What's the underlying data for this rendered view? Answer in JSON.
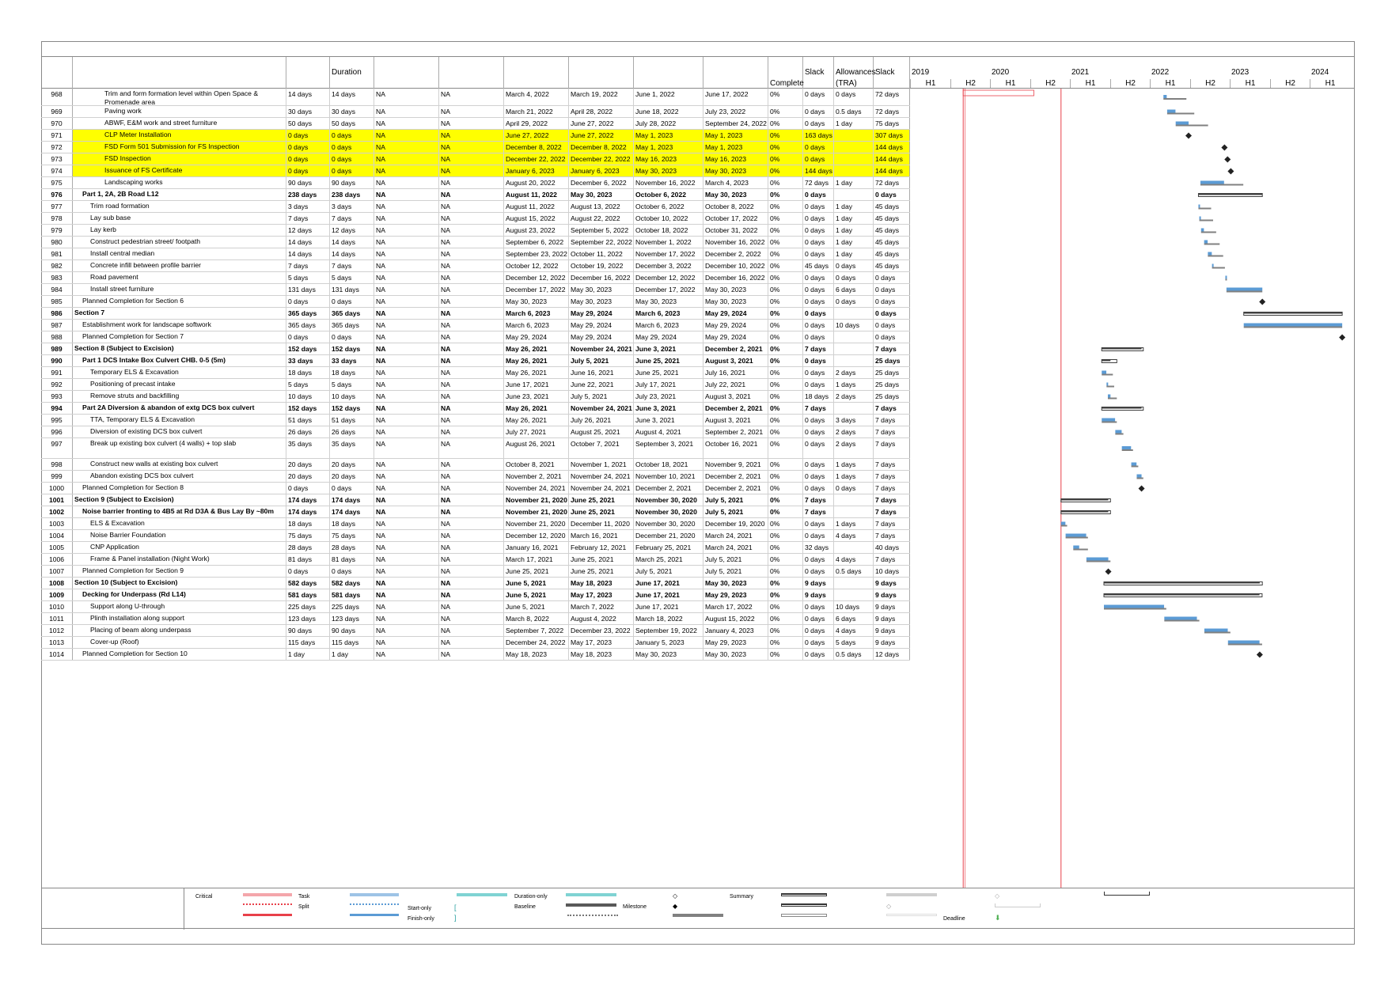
{
  "header": {
    "duration_label": "Duration",
    "complete_label": "Complete",
    "slack_label": "Slack",
    "allowances_label_1": "Allowances",
    "allowances_label_2": "(TRA)",
    "slack2_label": "Slack"
  },
  "timeline": {
    "years": [
      "2019",
      "2020",
      "2021",
      "2022",
      "2023",
      "2024"
    ],
    "halves": [
      "H1",
      "H2",
      "H1",
      "H2",
      "H1",
      "H2",
      "H1",
      "H2",
      "H1",
      "H2",
      "H1"
    ]
  },
  "rows": [
    {
      "id": "968",
      "name": "Trim and form formation level within Open Space & Promenade area",
      "d1": "14 days",
      "d2": "14 days",
      "n1": "NA",
      "n2": "NA",
      "s": "March 4, 2022",
      "f": "March 19, 2022",
      "s2": "June 1, 2022",
      "f2": "June 17, 2022",
      "pc": "0%",
      "sl": "0 days",
      "al": "0 days",
      "sl2": "72 days",
      "lv": 3,
      "tall": 1
    },
    {
      "id": "969",
      "name": "Paving work",
      "d1": "30 days",
      "d2": "30 days",
      "n1": "NA",
      "n2": "NA",
      "s": "March 21, 2022",
      "f": "April 28, 2022",
      "s2": "June 18, 2022",
      "f2": "July 23, 2022",
      "pc": "0%",
      "sl": "0 days",
      "al": "0.5 days",
      "sl2": "72 days",
      "lv": 3
    },
    {
      "id": "970",
      "name": "ABWF, E&M work and street furniture",
      "d1": "50 days",
      "d2": "50 days",
      "n1": "NA",
      "n2": "NA",
      "s": "April 29, 2022",
      "f": "June 27, 2022",
      "s2": "July 28, 2022",
      "f2": "September 24, 2022",
      "pc": "0%",
      "sl": "0 days",
      "al": "1 day",
      "sl2": "75 days",
      "lv": 3
    },
    {
      "id": "971",
      "name": "CLP Meter Installation",
      "d1": "0 days",
      "d2": "0 days",
      "n1": "NA",
      "n2": "NA",
      "s": "June 27, 2022",
      "f": "June 27, 2022",
      "s2": "May 1, 2023",
      "f2": "May 1, 2023",
      "pc": "0%",
      "sl": "163 days",
      "al": "",
      "sl2": "307 days",
      "lv": 3,
      "hl": 1
    },
    {
      "id": "972",
      "name": "FSD Form 501 Submission for FS Inspection",
      "d1": "0 days",
      "d2": "0 days",
      "n1": "NA",
      "n2": "NA",
      "s": "December 8, 2022",
      "f": "December 8, 2022",
      "s2": "May 1, 2023",
      "f2": "May 1, 2023",
      "pc": "0%",
      "sl": "0 days",
      "al": "",
      "sl2": "144 days",
      "lv": 3,
      "hl": 1
    },
    {
      "id": "973",
      "name": "FSD Inspection",
      "d1": "0 days",
      "d2": "0 days",
      "n1": "NA",
      "n2": "NA",
      "s": "December 22, 2022",
      "f": "December 22, 2022",
      "s2": "May 16, 2023",
      "f2": "May 16, 2023",
      "pc": "0%",
      "sl": "0 days",
      "al": "",
      "sl2": "144 days",
      "lv": 3,
      "hl": 1
    },
    {
      "id": "974",
      "name": "Issuance of FS Certificate",
      "d1": "0 days",
      "d2": "0 days",
      "n1": "NA",
      "n2": "NA",
      "s": "January 6, 2023",
      "f": "January 6, 2023",
      "s2": "May 30, 2023",
      "f2": "May 30, 2023",
      "pc": "0%",
      "sl": "144 days",
      "al": "",
      "sl2": "144 days",
      "lv": 3,
      "hl": 1
    },
    {
      "id": "975",
      "name": "Landscaping works",
      "d1": "90 days",
      "d2": "90 days",
      "n1": "NA",
      "n2": "NA",
      "s": "August 20, 2022",
      "f": "December 6, 2022",
      "s2": "November 16, 2022",
      "f2": "March 4, 2023",
      "pc": "0%",
      "sl": "72 days",
      "al": "1 day",
      "sl2": "72 days",
      "lv": 3
    },
    {
      "id": "976",
      "name": "Part 1, 2A, 2B   Road L12",
      "d1": "238 days",
      "d2": "238 days",
      "n1": "NA",
      "n2": "NA",
      "s": "August 11, 2022",
      "f": "May 30, 2023",
      "s2": "October 6, 2022",
      "f2": "May 30, 2023",
      "pc": "0%",
      "sl": "0 days",
      "al": "",
      "sl2": "0 days",
      "lv": 1,
      "b": 1
    },
    {
      "id": "977",
      "name": "Trim road formation",
      "d1": "3 days",
      "d2": "3 days",
      "n1": "NA",
      "n2": "NA",
      "s": "August 11, 2022",
      "f": "August 13, 2022",
      "s2": "October 6, 2022",
      "f2": "October 8, 2022",
      "pc": "0%",
      "sl": "0 days",
      "al": "1 day",
      "sl2": "45 days",
      "lv": 2
    },
    {
      "id": "978",
      "name": "Lay sub base",
      "d1": "7 days",
      "d2": "7 days",
      "n1": "NA",
      "n2": "NA",
      "s": "August 15, 2022",
      "f": "August 22, 2022",
      "s2": "October 10, 2022",
      "f2": "October 17, 2022",
      "pc": "0%",
      "sl": "0 days",
      "al": "1 day",
      "sl2": "45 days",
      "lv": 2
    },
    {
      "id": "979",
      "name": "Lay kerb",
      "d1": "12 days",
      "d2": "12 days",
      "n1": "NA",
      "n2": "NA",
      "s": "August 23, 2022",
      "f": "September 5, 2022",
      "s2": "October 18, 2022",
      "f2": "October 31, 2022",
      "pc": "0%",
      "sl": "0 days",
      "al": "1 day",
      "sl2": "45 days",
      "lv": 2
    },
    {
      "id": "980",
      "name": "Construct pedestrian street/ footpath",
      "d1": "14 days",
      "d2": "14 days",
      "n1": "NA",
      "n2": "NA",
      "s": "September 6, 2022",
      "f": "September 22, 2022",
      "s2": "November 1, 2022",
      "f2": "November 16, 2022",
      "pc": "0%",
      "sl": "0 days",
      "al": "1 day",
      "sl2": "45 days",
      "lv": 2
    },
    {
      "id": "981",
      "name": "Install central median",
      "d1": "14 days",
      "d2": "14 days",
      "n1": "NA",
      "n2": "NA",
      "s": "September 23, 2022",
      "f": "October 11, 2022",
      "s2": "November 17, 2022",
      "f2": "December 2, 2022",
      "pc": "0%",
      "sl": "0 days",
      "al": "1 day",
      "sl2": "45 days",
      "lv": 2
    },
    {
      "id": "982",
      "name": "Concrete infill between profile barrier",
      "d1": "7 days",
      "d2": "7 days",
      "n1": "NA",
      "n2": "NA",
      "s": "October 12, 2022",
      "f": "October 19, 2022",
      "s2": "December 3, 2022",
      "f2": "December 10, 2022",
      "pc": "0%",
      "sl": "45 days",
      "al": "0 days",
      "sl2": "45 days",
      "lv": 2
    },
    {
      "id": "983",
      "name": "Road pavement",
      "d1": "5 days",
      "d2": "5 days",
      "n1": "NA",
      "n2": "NA",
      "s": "December 12, 2022",
      "f": "December 16, 2022",
      "s2": "December 12, 2022",
      "f2": "December 16, 2022",
      "pc": "0%",
      "sl": "0 days",
      "al": "0 days",
      "sl2": "0 days",
      "lv": 2
    },
    {
      "id": "984",
      "name": "Install street furniture",
      "d1": "131 days",
      "d2": "131 days",
      "n1": "NA",
      "n2": "NA",
      "s": "December 17, 2022",
      "f": "May 30, 2023",
      "s2": "December 17, 2022",
      "f2": "May 30, 2023",
      "pc": "0%",
      "sl": "0 days",
      "al": "6 days",
      "sl2": "0 days",
      "lv": 2
    },
    {
      "id": "985",
      "name": "Planned Completion for Section 6",
      "d1": "0 days",
      "d2": "0 days",
      "n1": "NA",
      "n2": "NA",
      "s": "May 30, 2023",
      "f": "May 30, 2023",
      "s2": "May 30, 2023",
      "f2": "May 30, 2023",
      "pc": "0%",
      "sl": "0 days",
      "al": "0 days",
      "sl2": "0 days",
      "lv": 1
    },
    {
      "id": "986",
      "name": "Section 7",
      "d1": "365 days",
      "d2": "365 days",
      "n1": "NA",
      "n2": "NA",
      "s": "March 6, 2023",
      "f": "May 29, 2024",
      "s2": "March 6, 2023",
      "f2": "May 29, 2024",
      "pc": "0%",
      "sl": "0 days",
      "al": "",
      "sl2": "0 days",
      "lv": 0,
      "b": 1
    },
    {
      "id": "987",
      "name": "Establishment work for landscape softwork",
      "d1": "365 days",
      "d2": "365 days",
      "n1": "NA",
      "n2": "NA",
      "s": "March 6, 2023",
      "f": "May 29, 2024",
      "s2": "March 6, 2023",
      "f2": "May 29, 2024",
      "pc": "0%",
      "sl": "0 days",
      "al": "10 days",
      "sl2": "0 days",
      "lv": 1
    },
    {
      "id": "988",
      "name": "Planned Completion for Section 7",
      "d1": "0 days",
      "d2": "0 days",
      "n1": "NA",
      "n2": "NA",
      "s": "May 29, 2024",
      "f": "May 29, 2024",
      "s2": "May 29, 2024",
      "f2": "May 29, 2024",
      "pc": "0%",
      "sl": "0 days",
      "al": "",
      "sl2": "0 days",
      "lv": 1
    },
    {
      "id": "989",
      "name": "Section 8 (Subject to Excision)",
      "d1": "152 days",
      "d2": "152 days",
      "n1": "NA",
      "n2": "NA",
      "s": "May 26, 2021",
      "f": "November 24, 2021",
      "s2": "June 3, 2021",
      "f2": "December 2, 2021",
      "pc": "0%",
      "sl": "7 days",
      "al": "",
      "sl2": "7 days",
      "lv": 0,
      "b": 1
    },
    {
      "id": "990",
      "name": "Part 1   DCS Intake Box Culvert   CHB. 0-5 (5m)",
      "d1": "33 days",
      "d2": "33 days",
      "n1": "NA",
      "n2": "NA",
      "s": "May 26, 2021",
      "f": "July 5, 2021",
      "s2": "June 25, 2021",
      "f2": "August 3, 2021",
      "pc": "0%",
      "sl": "0 days",
      "al": "",
      "sl2": "25 days",
      "lv": 1,
      "b": 1
    },
    {
      "id": "991",
      "name": "Temporary ELS & Excavation",
      "d1": "18 days",
      "d2": "18 days",
      "n1": "NA",
      "n2": "NA",
      "s": "May 26, 2021",
      "f": "June 16, 2021",
      "s2": "June 25, 2021",
      "f2": "July 16, 2021",
      "pc": "0%",
      "sl": "0 days",
      "al": "2 days",
      "sl2": "25 days",
      "lv": 2
    },
    {
      "id": "992",
      "name": "Positioning of precast intake",
      "d1": "5 days",
      "d2": "5 days",
      "n1": "NA",
      "n2": "NA",
      "s": "June 17, 2021",
      "f": "June 22, 2021",
      "s2": "July 17, 2021",
      "f2": "July 22, 2021",
      "pc": "0%",
      "sl": "0 days",
      "al": "1 days",
      "sl2": "25 days",
      "lv": 2
    },
    {
      "id": "993",
      "name": "Remove struts and backfilling",
      "d1": "10 days",
      "d2": "10 days",
      "n1": "NA",
      "n2": "NA",
      "s": "June 23, 2021",
      "f": "July 5, 2021",
      "s2": "July 23, 2021",
      "f2": "August 3, 2021",
      "pc": "0%",
      "sl": "18 days",
      "al": "2 days",
      "sl2": "25 days",
      "lv": 2
    },
    {
      "id": "994",
      "name": "Part 2A   Diversion & abandon of extg DCS box culvert",
      "d1": "152 days",
      "d2": "152 days",
      "n1": "NA",
      "n2": "NA",
      "s": "May 26, 2021",
      "f": "November 24, 2021",
      "s2": "June 3, 2021",
      "f2": "December 2, 2021",
      "pc": "0%",
      "sl": "7 days",
      "al": "",
      "sl2": "7 days",
      "lv": 1,
      "b": 1
    },
    {
      "id": "995",
      "name": "TTA, Temporary ELS & Excavation",
      "d1": "51 days",
      "d2": "51 days",
      "n1": "NA",
      "n2": "NA",
      "s": "May 26, 2021",
      "f": "July 26, 2021",
      "s2": "June 3, 2021",
      "f2": "August 3, 2021",
      "pc": "0%",
      "sl": "0 days",
      "al": "3 days",
      "sl2": "7 days",
      "lv": 2
    },
    {
      "id": "996",
      "name": "Diversion of existing DCS box culvert",
      "d1": "26 days",
      "d2": "26 days",
      "n1": "NA",
      "n2": "NA",
      "s": "July 27, 2021",
      "f": "August 25, 2021",
      "s2": "August 4, 2021",
      "f2": "September 2, 2021",
      "pc": "0%",
      "sl": "0 days",
      "al": "2 days",
      "sl2": "7 days",
      "lv": 2
    },
    {
      "id": "997",
      "name": "Break up existing box culvert (4 walls) + top slab",
      "d1": "35 days",
      "d2": "35 days",
      "n1": "NA",
      "n2": "NA",
      "s": "August 26, 2021",
      "f": "October 7, 2021",
      "s2": "September 3, 2021",
      "f2": "October 16, 2021",
      "pc": "0%",
      "sl": "0 days",
      "al": "2 days",
      "sl2": "7 days",
      "lv": 2,
      "tall": 2
    },
    {
      "id": "998",
      "name": "Construct new walls at existing box culvert",
      "d1": "20 days",
      "d2": "20 days",
      "n1": "NA",
      "n2": "NA",
      "s": "October 8, 2021",
      "f": "November 1, 2021",
      "s2": "October 18, 2021",
      "f2": "November 9, 2021",
      "pc": "0%",
      "sl": "0 days",
      "al": "1 days",
      "sl2": "7 days",
      "lv": 2
    },
    {
      "id": "999",
      "name": "Abandon existing DCS box culvert",
      "d1": "20 days",
      "d2": "20 days",
      "n1": "NA",
      "n2": "NA",
      "s": "November 2, 2021",
      "f": "November 24, 2021",
      "s2": "November 10, 2021",
      "f2": "December 2, 2021",
      "pc": "0%",
      "sl": "0 days",
      "al": "1 days",
      "sl2": "7 days",
      "lv": 2
    },
    {
      "id": "1000",
      "name": "Planned Completion for Section 8",
      "d1": "0 days",
      "d2": "0 days",
      "n1": "NA",
      "n2": "NA",
      "s": "November 24, 2021",
      "f": "November 24, 2021",
      "s2": "December 2, 2021",
      "f2": "December 2, 2021",
      "pc": "0%",
      "sl": "0 days",
      "al": "0 days",
      "sl2": "7 days",
      "lv": 1
    },
    {
      "id": "1001",
      "name": "Section 9 (Subject to Excision)",
      "d1": "174 days",
      "d2": "174 days",
      "n1": "NA",
      "n2": "NA",
      "s": "November 21, 2020",
      "f": "June 25, 2021",
      "s2": "November 30, 2020",
      "f2": "July 5, 2021",
      "pc": "0%",
      "sl": "7 days",
      "al": "",
      "sl2": "7 days",
      "lv": 0,
      "b": 1
    },
    {
      "id": "1002",
      "name": "Noise barrier fronting to 4B5 at Rd D3A & Bus Lay By ~80m",
      "d1": "174 days",
      "d2": "174 days",
      "n1": "NA",
      "n2": "NA",
      "s": "November 21, 2020",
      "f": "June 25, 2021",
      "s2": "November 30, 2020",
      "f2": "July 5, 2021",
      "pc": "0%",
      "sl": "7 days",
      "al": "",
      "sl2": "7 days",
      "lv": 1,
      "b": 1
    },
    {
      "id": "1003",
      "name": "ELS & Excavation",
      "d1": "18 days",
      "d2": "18 days",
      "n1": "NA",
      "n2": "NA",
      "s": "November 21, 2020",
      "f": "December 11, 2020",
      "s2": "November 30, 2020",
      "f2": "December 19, 2020",
      "pc": "0%",
      "sl": "0 days",
      "al": "1 days",
      "sl2": "7 days",
      "lv": 2
    },
    {
      "id": "1004",
      "name": "Noise Barrier Foundation",
      "d1": "75 days",
      "d2": "75 days",
      "n1": "NA",
      "n2": "NA",
      "s": "December 12, 2020",
      "f": "March 16, 2021",
      "s2": "December 21, 2020",
      "f2": "March 24, 2021",
      "pc": "0%",
      "sl": "0 days",
      "al": "4 days",
      "sl2": "7 days",
      "lv": 2
    },
    {
      "id": "1005",
      "name": "CNP Application",
      "d1": "28 days",
      "d2": "28 days",
      "n1": "NA",
      "n2": "NA",
      "s": "January 16, 2021",
      "f": "February 12, 2021",
      "s2": "February 25, 2021",
      "f2": "March 24, 2021",
      "pc": "0%",
      "sl": "32 days",
      "al": "",
      "sl2": "40 days",
      "lv": 2
    },
    {
      "id": "1006",
      "name": "Frame & Panel installation (Night Work)",
      "d1": "81 days",
      "d2": "81 days",
      "n1": "NA",
      "n2": "NA",
      "s": "March 17, 2021",
      "f": "June 25, 2021",
      "s2": "March 25, 2021",
      "f2": "July 5, 2021",
      "pc": "0%",
      "sl": "0 days",
      "al": "4 days",
      "sl2": "7 days",
      "lv": 2
    },
    {
      "id": "1007",
      "name": "Planned Completion for Section 9",
      "d1": "0 days",
      "d2": "0 days",
      "n1": "NA",
      "n2": "NA",
      "s": "June 25, 2021",
      "f": "June 25, 2021",
      "s2": "July 5, 2021",
      "f2": "July 5, 2021",
      "pc": "0%",
      "sl": "0 days",
      "al": "0.5 days",
      "sl2": "10 days",
      "lv": 1
    },
    {
      "id": "1008",
      "name": "Section 10 (Subject to Excision)",
      "d1": "582 days",
      "d2": "582 days",
      "n1": "NA",
      "n2": "NA",
      "s": "June 5, 2021",
      "f": "May 18, 2023",
      "s2": "June 17, 2021",
      "f2": "May 30, 2023",
      "pc": "0%",
      "sl": "9 days",
      "al": "",
      "sl2": "9 days",
      "lv": 0,
      "b": 1
    },
    {
      "id": "1009",
      "name": "Decking for Underpass (Rd L14)",
      "d1": "581 days",
      "d2": "581 days",
      "n1": "NA",
      "n2": "NA",
      "s": "June 5, 2021",
      "f": "May 17, 2023",
      "s2": "June 17, 2021",
      "f2": "May 29, 2023",
      "pc": "0%",
      "sl": "9 days",
      "al": "",
      "sl2": "9 days",
      "lv": 1,
      "b": 1
    },
    {
      "id": "1010",
      "name": "Support along U-through",
      "d1": "225 days",
      "d2": "225 days",
      "n1": "NA",
      "n2": "NA",
      "s": "June 5, 2021",
      "f": "March 7, 2022",
      "s2": "June 17, 2021",
      "f2": "March 17, 2022",
      "pc": "0%",
      "sl": "0 days",
      "al": "10 days",
      "sl2": "9 days",
      "lv": 2
    },
    {
      "id": "1011",
      "name": "Plinth installation along support",
      "d1": "123 days",
      "d2": "123 days",
      "n1": "NA",
      "n2": "NA",
      "s": "March 8, 2022",
      "f": "August 4, 2022",
      "s2": "March 18, 2022",
      "f2": "August 15, 2022",
      "pc": "0%",
      "sl": "0 days",
      "al": "6 days",
      "sl2": "9 days",
      "lv": 2
    },
    {
      "id": "1012",
      "name": "Placing of beam along underpass",
      "d1": "90 days",
      "d2": "90 days",
      "n1": "NA",
      "n2": "NA",
      "s": "September 7, 2022",
      "f": "December 23, 2022",
      "s2": "September 19, 2022",
      "f2": "January 4, 2023",
      "pc": "0%",
      "sl": "0 days",
      "al": "4 days",
      "sl2": "9 days",
      "lv": 2
    },
    {
      "id": "1013",
      "name": "Cover-up (Roof)",
      "d1": "115 days",
      "d2": "115 days",
      "n1": "NA",
      "n2": "NA",
      "s": "December 24, 2022",
      "f": "May 17, 2023",
      "s2": "January 5, 2023",
      "f2": "May 29, 2023",
      "pc": "0%",
      "sl": "0 days",
      "al": "5 days",
      "sl2": "9 days",
      "lv": 2
    },
    {
      "id": "1014",
      "name": "Planned Completion for Section 10",
      "d1": "1 day",
      "d2": "1 day",
      "n1": "NA",
      "n2": "NA",
      "s": "May 18, 2023",
      "f": "May 18, 2023",
      "s2": "May 30, 2023",
      "f2": "May 30, 2023",
      "pc": "0%",
      "sl": "0 days",
      "al": "0.5 days",
      "sl2": "12 days",
      "lv": 1
    }
  ],
  "legend": {
    "critical": "Critical",
    "task": "Task",
    "split": "Split",
    "start_only": "Start-only",
    "finish_only": "Finish-only",
    "duration_only": "Duration-only",
    "baseline": "Baseline",
    "milestone": "Milestone",
    "summary": "Summary",
    "deadline": "Deadline"
  },
  "colors": {
    "highlight": "#ffff00",
    "task_bar": "#5b9bd5",
    "critical": "#e8404a",
    "summary_bar": "#404040",
    "baseline": "#a6a6a6"
  }
}
